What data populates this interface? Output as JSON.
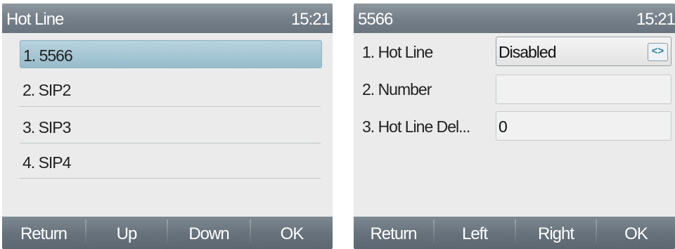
{
  "left_screen": {
    "title": "Hot Line",
    "clock": "15:21",
    "items": [
      {
        "label": "1. 5566"
      },
      {
        "label": "2. SIP2"
      },
      {
        "label": "3. SIP3"
      },
      {
        "label": "4. SIP4"
      }
    ],
    "softkeys": [
      "Return",
      "Up",
      "Down",
      "OK"
    ]
  },
  "right_screen": {
    "title": "5566",
    "clock": "15:21",
    "rows": [
      {
        "label": "1.  Hot Line",
        "value": "Disabled"
      },
      {
        "label": "2.  Number",
        "value": ""
      },
      {
        "label": "3.  Hot Line Del...",
        "value": "0"
      }
    ],
    "select_arrows": "<>",
    "softkeys": [
      "Return",
      "Left",
      "Right",
      "OK"
    ]
  }
}
